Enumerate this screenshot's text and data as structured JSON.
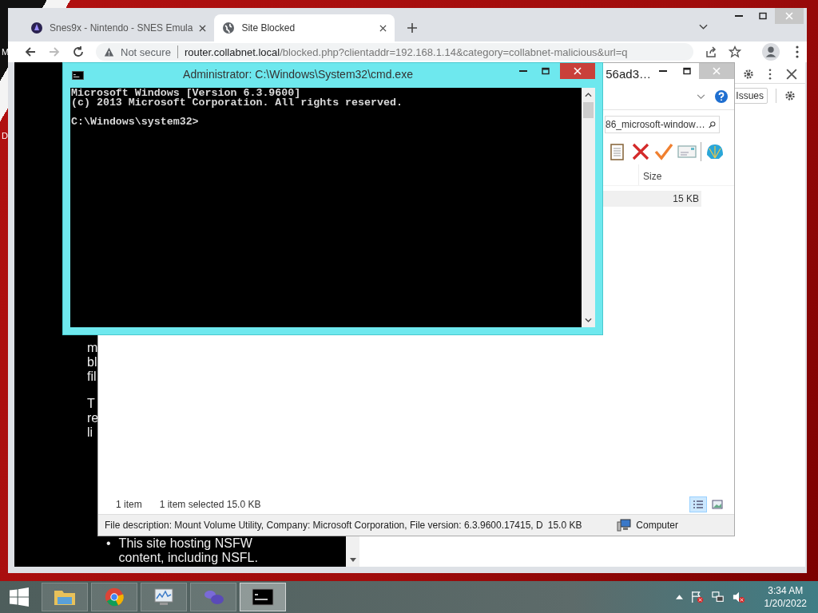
{
  "desktop": {
    "labels": [
      "M",
      "D"
    ]
  },
  "browser": {
    "tabs": [
      {
        "title": "Snes9x - Nintendo - SNES Emula",
        "selected": false
      },
      {
        "title": "Site Blocked",
        "selected": true
      }
    ],
    "address": {
      "security": "Not secure",
      "host": "router.collabnet.local",
      "path": "/blocked.php?clientaddr=192.168.1.14&category=collabnet-malicious&url=q"
    },
    "page": {
      "paragraphs": [
        [
          "m",
          "bl",
          "fil"
        ],
        [
          "T",
          "re",
          "li"
        ]
      ],
      "bullets": [
        {
          "marker": "•",
          "text": "This site hosting NSFW content, including NSFL."
        }
      ]
    },
    "devtools": {
      "issues_button": "Issues"
    }
  },
  "explorer": {
    "title": "56ad3…",
    "search": "86_microsoft-window…",
    "columns": [
      "Size"
    ],
    "rows": [
      {
        "size": "15 KB",
        "selected": true
      }
    ],
    "status": {
      "count": "1 item",
      "selection": "1 item selected  15.0 KB"
    },
    "views": [
      {
        "kind": "details",
        "selected": true
      },
      {
        "kind": "thumbnails",
        "selected": false
      }
    ],
    "details": {
      "description": "File description: Mount Volume Utility, Company: Microsoft Corporation, File version: 6.3.9600.17415, D",
      "size": "15.0 KB",
      "zone": "Computer"
    }
  },
  "console": {
    "title": "Administrator: C:\\Windows\\System32\\cmd.exe",
    "header": [
      "Microsoft Windows [Version 6.3.9600]",
      "(c) 2013 Microsoft Corporation. All rights reserved."
    ],
    "prompt": "C:\\Windows\\system32>"
  },
  "taskbar": {
    "apps": [
      {
        "kind": "explorer",
        "selected": false
      },
      {
        "kind": "browser",
        "selected": false
      },
      {
        "kind": "monitor",
        "selected": false
      },
      {
        "kind": "emulator",
        "selected": false
      },
      {
        "kind": "console",
        "selected": true
      }
    ],
    "clock": {
      "time": "3:34 AM",
      "date": "1/20/2022"
    }
  }
}
